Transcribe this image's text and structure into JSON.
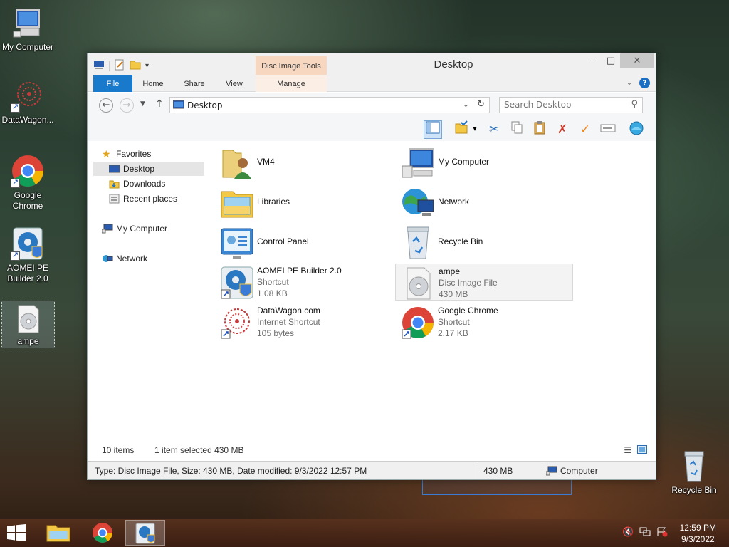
{
  "desktop": {
    "icons": [
      {
        "label": "My Computer",
        "icon": "computer-icon"
      },
      {
        "label": "DataWagon...",
        "icon": "datawagon-icon"
      },
      {
        "label": "Google Chrome",
        "icon": "chrome-icon"
      },
      {
        "label": "AOMEI PE Builder 2.0",
        "icon": "aomei-icon"
      },
      {
        "label": "ampe",
        "icon": "disc-image-icon"
      },
      {
        "label": "Recycle Bin",
        "icon": "recycle-bin-icon"
      }
    ]
  },
  "window": {
    "title": "Desktop",
    "controls": {
      "minimize": "–",
      "maximize": "□",
      "close": "✕"
    },
    "contextual_tab_group": "Disc Image Tools",
    "ribbon_tabs": [
      "File",
      "Home",
      "Share",
      "View",
      "Manage"
    ],
    "address": {
      "path": "Desktop"
    },
    "search": {
      "placeholder": "Search Desktop"
    }
  },
  "nav_pane": {
    "favorites_header": "Favorites",
    "favorites": [
      "Desktop",
      "Downloads",
      "Recent places"
    ],
    "my_computer": "My Computer",
    "network": "Network",
    "selected": "Desktop"
  },
  "items": [
    {
      "name": "VM4",
      "type": "",
      "size": "",
      "icon": "user-folder-icon"
    },
    {
      "name": "My Computer",
      "type": "",
      "size": "",
      "icon": "computer-icon"
    },
    {
      "name": "Libraries",
      "type": "",
      "size": "",
      "icon": "libraries-icon"
    },
    {
      "name": "Network",
      "type": "",
      "size": "",
      "icon": "network-icon"
    },
    {
      "name": "Control Panel",
      "type": "",
      "size": "",
      "icon": "control-panel-icon"
    },
    {
      "name": "Recycle Bin",
      "type": "",
      "size": "",
      "icon": "recycle-bin-icon"
    },
    {
      "name": "AOMEI PE Builder 2.0",
      "type": "Shortcut",
      "size": "1.08 KB",
      "icon": "aomei-icon"
    },
    {
      "name": "ampe",
      "type": "Disc Image File",
      "size": "430 MB",
      "icon": "disc-image-icon",
      "selected": true
    },
    {
      "name": "DataWagon.com",
      "type": "Internet Shortcut",
      "size": "105 bytes",
      "icon": "datawagon-icon"
    },
    {
      "name": "Google Chrome",
      "type": "Shortcut",
      "size": "2.17 KB",
      "icon": "chrome-icon"
    }
  ],
  "status": {
    "item_count": "10 items",
    "selection": "1 item selected  430 MB"
  },
  "details_bar": {
    "description": "Type: Disc Image File, Size: 430 MB, Date modified: 9/3/2022 12:57 PM",
    "size": "430 MB",
    "location": "Computer"
  },
  "taskbar": {
    "clock_time": "12:59 PM",
    "clock_date": "9/3/2022"
  },
  "colors": {
    "file_tab": "#1979ca",
    "context_tab": "#f7d7c0",
    "selection": "#cfe3f8"
  }
}
